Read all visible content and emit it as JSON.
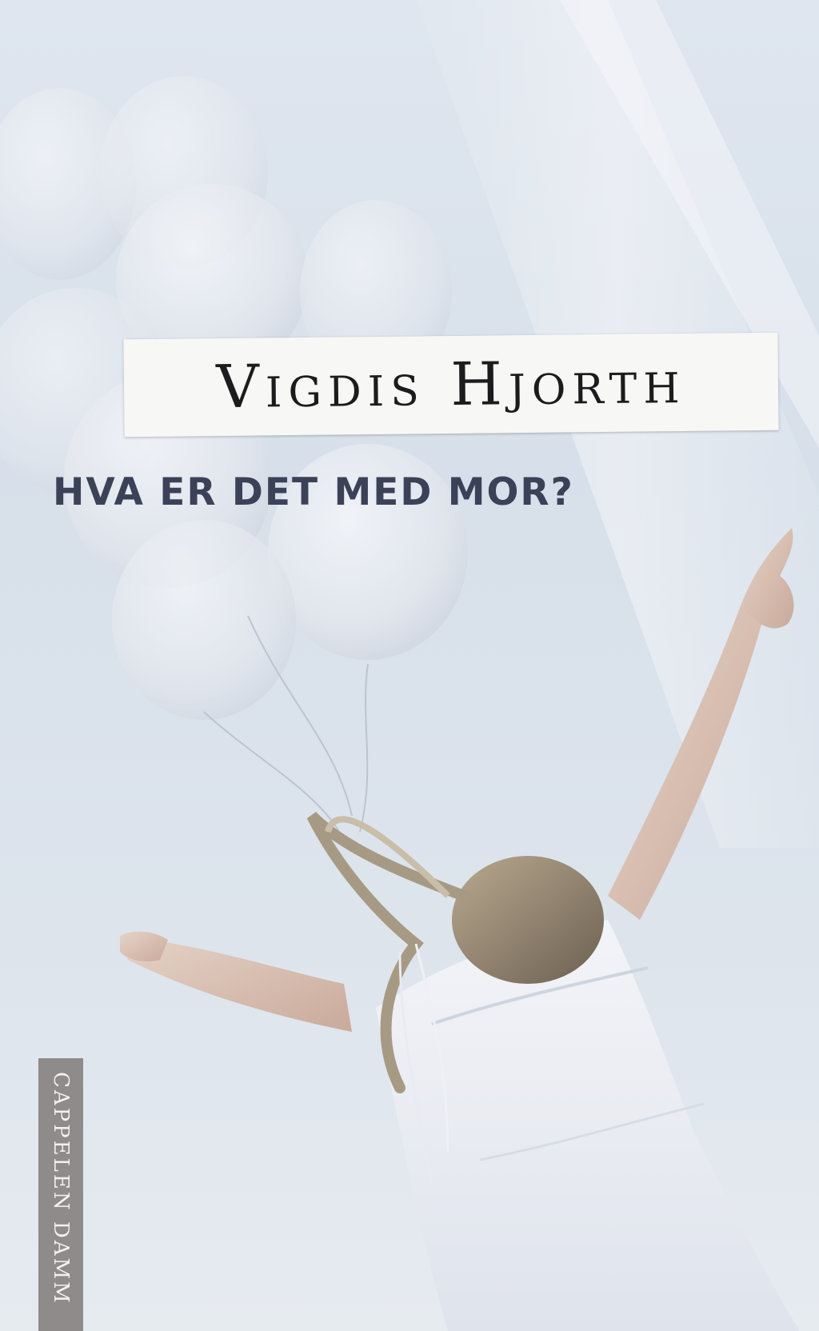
{
  "cover": {
    "author": "Vigdis Hjorth",
    "title": "HVA ER DET MED MOR?",
    "publisher": "CAPPELEN DAMM"
  },
  "icons": [
    "balloons-illustration",
    "girl-illustration",
    "publisher-logo-tab"
  ],
  "colors": {
    "sky": "#dfe6ef",
    "title": "#3b4258",
    "author": "#1c1c1e",
    "publisher_tab": "#8e8b8a"
  }
}
